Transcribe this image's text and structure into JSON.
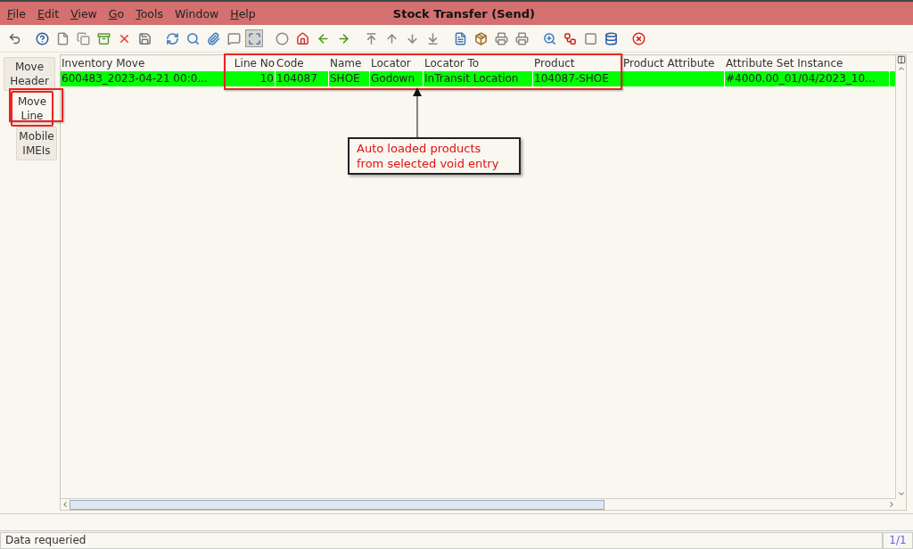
{
  "window": {
    "title": "Stock Transfer (Send)"
  },
  "menu": [
    {
      "label": "File",
      "mnemonic": true
    },
    {
      "label": "Edit",
      "mnemonic": true
    },
    {
      "label": "View",
      "mnemonic": true
    },
    {
      "label": "Go",
      "mnemonic": true
    },
    {
      "label": "Tools",
      "mnemonic": true
    },
    {
      "label": "Window",
      "mnemonic": false
    },
    {
      "label": "Help",
      "mnemonic": true
    }
  ],
  "toolbar_buttons": [
    {
      "selected": false
    },
    {
      "selected": false
    },
    {
      "selected": false
    },
    {
      "selected": false
    },
    {
      "selected": false
    },
    {
      "selected": false
    },
    {
      "selected": false
    },
    {
      "selected": false
    },
    {
      "selected": false
    },
    {
      "selected": false
    },
    {
      "selected": false
    },
    {
      "selected": true
    },
    {
      "selected": false
    },
    {
      "selected": false
    },
    {
      "selected": false
    },
    {
      "selected": false
    },
    {
      "selected": false
    },
    {
      "selected": false
    },
    {
      "selected": false
    },
    {
      "selected": false
    },
    {
      "selected": false
    },
    {
      "selected": false
    },
    {
      "selected": false
    },
    {
      "selected": false
    },
    {
      "selected": false
    },
    {
      "selected": false
    },
    {
      "selected": false
    },
    {
      "selected": false
    },
    {
      "selected": false
    }
  ],
  "tabs": [
    {
      "label": "Move Header",
      "selected": false
    },
    {
      "label": "Move Line",
      "selected": true
    },
    {
      "label": "Mobile IMEIs",
      "selected": false
    }
  ],
  "table": {
    "columns": [
      "Inventory Move",
      "Line No",
      "Code",
      "Name",
      "Locator",
      "Locator To",
      "Product",
      "Product Attribute",
      "Attribute Set Instance"
    ],
    "rows": [
      {
        "selected": true,
        "cells": [
          "600483_2023-04-21 00:0...",
          "10",
          "104087",
          "SHOE",
          "Godown",
          "InTransit Location",
          "104087-SHOE",
          "",
          "#4000.00_01/04/2023_10..."
        ]
      }
    ]
  },
  "annotation": {
    "text": "Auto loaded products from selected void entry"
  },
  "status_bar": {
    "message": "Data requeried",
    "record": "1/1"
  }
}
